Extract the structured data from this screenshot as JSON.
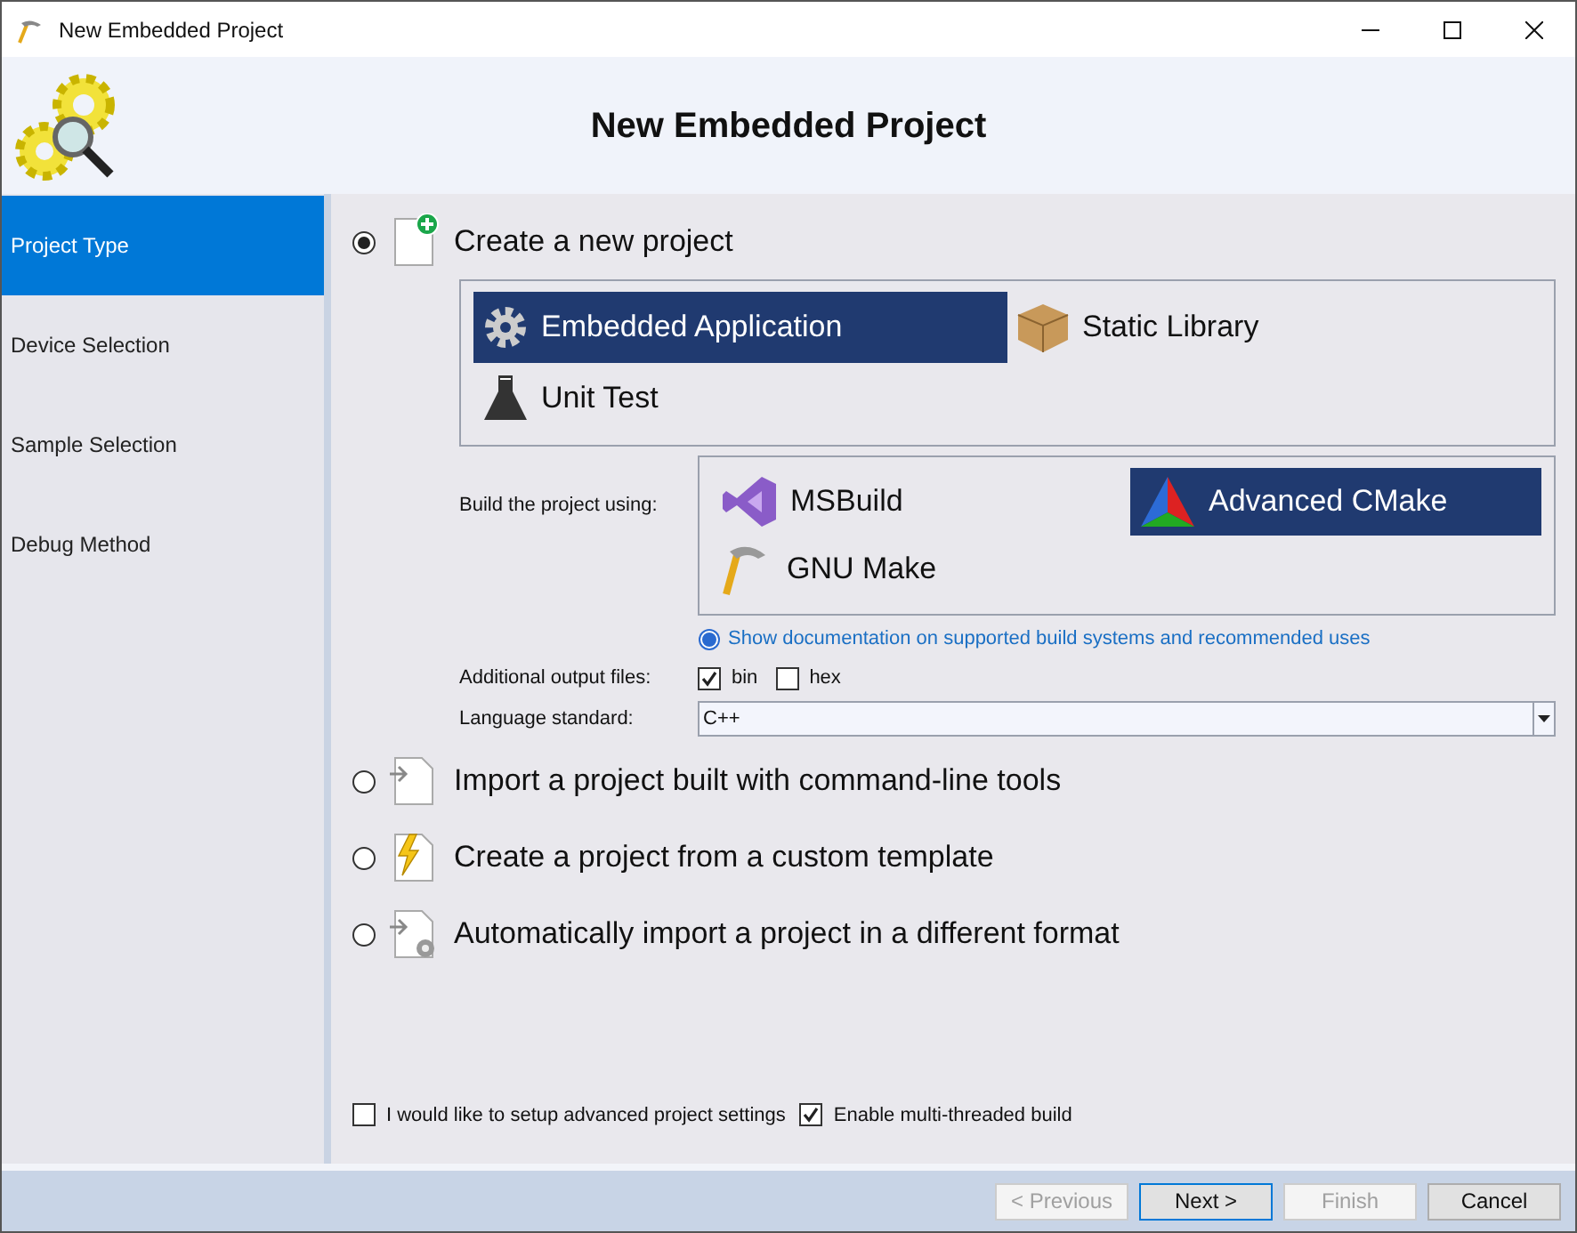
{
  "window": {
    "title": "New Embedded Project"
  },
  "header": {
    "title": "New Embedded Project"
  },
  "sidebar": {
    "items": [
      {
        "label": "Project Type",
        "selected": true
      },
      {
        "label": "Device Selection",
        "selected": false
      },
      {
        "label": "Sample Selection",
        "selected": false
      },
      {
        "label": "Debug Method",
        "selected": false
      }
    ]
  },
  "create_option": {
    "kind": "new",
    "label": "Create a new project",
    "selected": true
  },
  "project_types": [
    {
      "kind": "application",
      "label": "Embedded Application",
      "selected": true
    },
    {
      "kind": "library",
      "label": "Static Library",
      "selected": false
    },
    {
      "kind": "test",
      "label": "Unit Test",
      "selected": false
    }
  ],
  "build": {
    "label": "Build the project using:",
    "systems": [
      {
        "kind": "msbuild",
        "label": "MSBuild",
        "selected": false
      },
      {
        "kind": "cmake",
        "label": "Advanced CMake",
        "selected": true
      },
      {
        "kind": "make",
        "label": "GNU Make",
        "selected": false
      }
    ],
    "doc_link": "Show documentation on supported build systems and recommended uses"
  },
  "output_files": {
    "label": "Additional output files:",
    "options": [
      {
        "label": "bin",
        "checked": true
      },
      {
        "label": "hex",
        "checked": false
      }
    ]
  },
  "language": {
    "label": "Language standard:",
    "value": "C++"
  },
  "other_options": [
    {
      "kind": "import",
      "label": "Import a project built with command-line tools",
      "selected": false
    },
    {
      "kind": "template",
      "label": "Create a project from a custom template",
      "selected": false
    },
    {
      "kind": "convert",
      "label": "Automatically import a project in a different format",
      "selected": false
    }
  ],
  "bottom_checkboxes": [
    {
      "label": "I would like to setup advanced project settings",
      "checked": false
    },
    {
      "label": "Enable multi-threaded build",
      "checked": true
    }
  ],
  "buttons": [
    {
      "label": "< Previous",
      "disabled": true,
      "default": false
    },
    {
      "label": "Next >",
      "disabled": false,
      "default": true
    },
    {
      "label": "Finish",
      "disabled": true,
      "default": false
    },
    {
      "label": "Cancel",
      "disabled": false,
      "default": false
    }
  ]
}
